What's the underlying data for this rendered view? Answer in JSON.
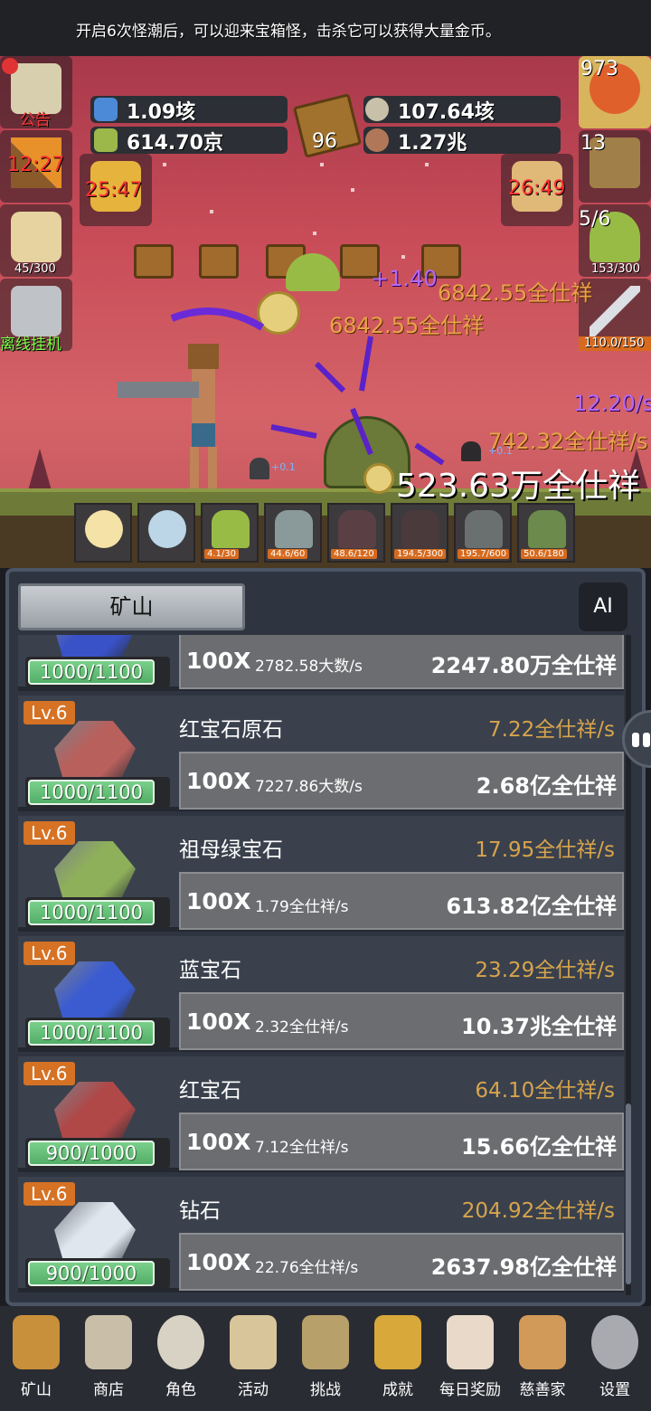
{
  "notice": "开启6次怪潮后，可以迎来宝箱怪，击杀它可以获得大量金币。",
  "resources": {
    "res1": "1.09垓",
    "res2": "614.70京",
    "book_count": "96",
    "res3": "107.64垓",
    "res4": "1.27兆"
  },
  "left_panel": {
    "announcement": "公告",
    "torch_timer": "12:27",
    "beer_count": "45/300",
    "offline": "离线挂机"
  },
  "right_panel": {
    "potion_count": "973",
    "chest_count": "13",
    "slime_count": "5/6",
    "slime_cap": "153/300",
    "sword_cap": "110.0/150"
  },
  "timers": {
    "bag_timer": "25:47",
    "bread_timer": "26:49"
  },
  "battle": {
    "float1": "+1.40",
    "float2": "6842.55全仕祥",
    "float3": "6842.55全仕祥",
    "dps": "12.20/s",
    "gold_rate": "742.32全仕祥/s",
    "total": "523.63万全仕祥",
    "tiny1": "+0.1",
    "tiny2": "+0.1"
  },
  "units": [
    {
      "label": ""
    },
    {
      "label": ""
    },
    {
      "label": "4.1/30"
    },
    {
      "label": "44.6/60"
    },
    {
      "label": "48.6/120"
    },
    {
      "label": "194.5/300"
    },
    {
      "label": "195.7/600"
    },
    {
      "label": "50.6/180"
    }
  ],
  "panel": {
    "tab": "矿山",
    "ai": "AI"
  },
  "gems": [
    {
      "level": "",
      "capacity": "1000/1100",
      "name": "",
      "rate": "",
      "mult": "100X",
      "up_rate": "2782.58大数/s",
      "cost": "2247.80万全仕祥",
      "color": "#3a52c8"
    },
    {
      "level": "Lv.6",
      "capacity": "1000/1100",
      "name": "红宝石原石",
      "rate": "7.22全仕祥/s",
      "mult": "100X",
      "up_rate": "7227.86大数/s",
      "cost": "2.68亿全仕祥",
      "color": "#b8605c"
    },
    {
      "level": "Lv.6",
      "capacity": "1000/1100",
      "name": "祖母绿宝石",
      "rate": "17.95全仕祥/s",
      "mult": "100X",
      "up_rate": "1.79全仕祥/s",
      "cost": "613.82亿全仕祥",
      "color": "#8fb05a"
    },
    {
      "level": "Lv.6",
      "capacity": "1000/1100",
      "name": "蓝宝石",
      "rate": "23.29全仕祥/s",
      "mult": "100X",
      "up_rate": "2.32全仕祥/s",
      "cost": "10.37兆全仕祥",
      "color": "#3b5cd0"
    },
    {
      "level": "Lv.6",
      "capacity": "900/1000",
      "name": "红宝石",
      "rate": "64.10全仕祥/s",
      "mult": "100X",
      "up_rate": "7.12全仕祥/s",
      "cost": "15.66亿全仕祥",
      "color": "#b04848"
    },
    {
      "level": "Lv.6",
      "capacity": "900/1000",
      "name": "钻石",
      "rate": "204.92全仕祥/s",
      "mult": "100X",
      "up_rate": "22.76全仕祥/s",
      "cost": "2637.98亿全仕祥",
      "color": "#dfe6ee"
    }
  ],
  "nav": [
    {
      "label": "矿山",
      "icon": "lantern-icon"
    },
    {
      "label": "商店",
      "icon": "shell-icon"
    },
    {
      "label": "角色",
      "icon": "skull-icon"
    },
    {
      "label": "活动",
      "icon": "scroll-icon"
    },
    {
      "label": "挑战",
      "icon": "map-icon"
    },
    {
      "label": "成就",
      "icon": "key-icon"
    },
    {
      "label": "每日奖励",
      "icon": "envelope-icon"
    },
    {
      "label": "慈善家",
      "icon": "bread-icon"
    },
    {
      "label": "设置",
      "icon": "gear-icon"
    }
  ]
}
